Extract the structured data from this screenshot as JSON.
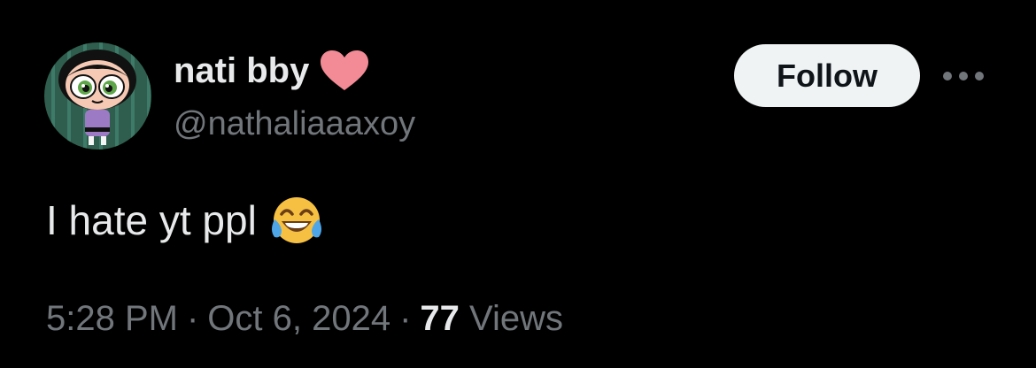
{
  "author": {
    "display_name": "nati bby",
    "handle": "@nathaliaaaxoy",
    "avatar": "powerpuff-girl-avatar",
    "badge_icon": "pink-heart-icon",
    "badge_color": "#f28b96"
  },
  "actions": {
    "follow_label": "Follow",
    "more_icon": "more-horizontal-icon"
  },
  "tweet": {
    "text": "I hate yt ppl",
    "emoji": "face-with-tears-of-joy-emoji"
  },
  "meta": {
    "time": "5:28 PM",
    "separator": "·",
    "date": "Oct 6, 2024",
    "views_count": "77",
    "views_label": "Views"
  },
  "colors": {
    "background": "#000000",
    "primary_text": "#e7e9ea",
    "secondary_text": "#71767b",
    "follow_bg": "#eff3f4",
    "follow_text": "#0f1419"
  }
}
